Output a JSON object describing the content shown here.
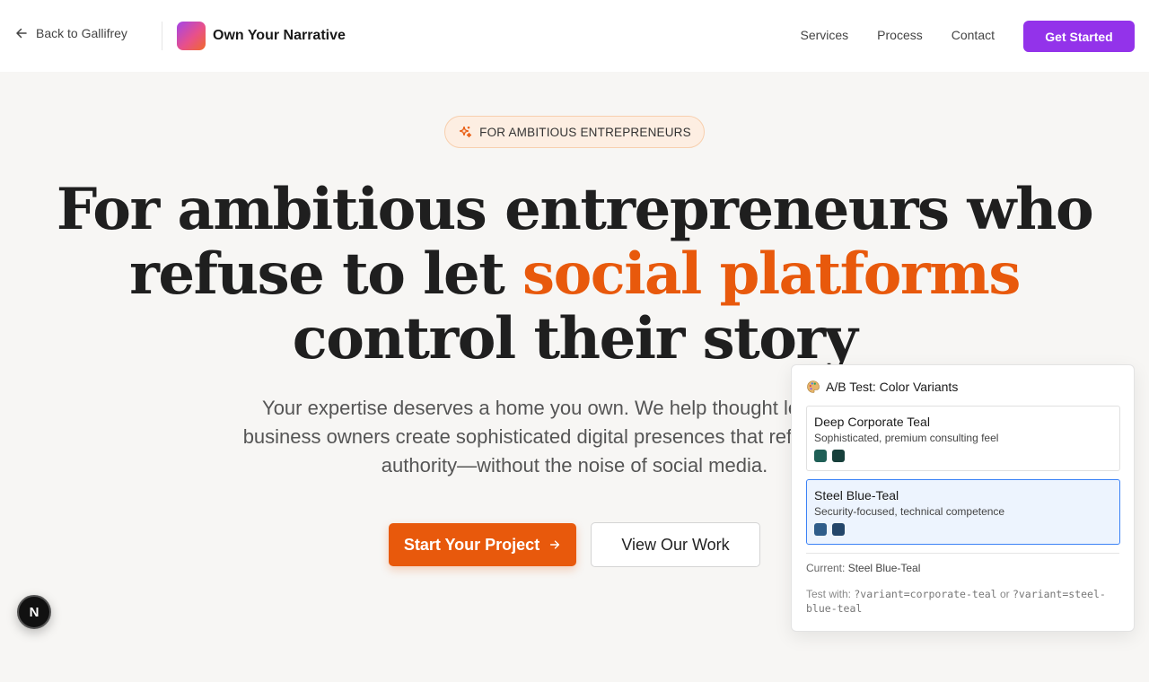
{
  "header": {
    "back_label": "Back to Gallifrey",
    "brand_name": "Own Your Narrative",
    "nav": [
      "Services",
      "Process",
      "Contact"
    ],
    "cta_label": "Get Started"
  },
  "hero": {
    "badge": "FOR AMBITIOUS ENTREPRENEURS",
    "headline_line1": "For ambitious entrepreneurs who",
    "headline_line2_pre": "refuse to let ",
    "headline_accent": "social platforms",
    "headline_line3": "control their story",
    "subtext": "Your expertise deserves a home you own. We help thought leaders and business owners create sophisticated digital presences that reflect your true authority—without the noise of social media.",
    "primary_button": "Start Your Project",
    "secondary_button": "View Our Work"
  },
  "floating_button": {
    "label": "N"
  },
  "ab_panel": {
    "title": "A/B Test: Color Variants",
    "variants": [
      {
        "name": "Deep Corporate Teal",
        "description": "Sophisticated, premium consulting feel",
        "colors": [
          "#1f5f56",
          "#17403b"
        ],
        "selected": false
      },
      {
        "name": "Steel Blue-Teal",
        "description": "Security-focused, technical competence",
        "colors": [
          "#2f5d8a",
          "#24466a"
        ],
        "selected": true
      }
    ],
    "current_label": "Current: ",
    "current_value": "Steel Blue-Teal",
    "test_with_label": "Test with: ",
    "test_param_1": "?variant=corporate-teal",
    "test_or": " or ",
    "test_param_2": "?variant=steel-blue-teal"
  },
  "colors": {
    "accent": "#e8590c",
    "cta": "#9333ea",
    "badge_bg": "#fdeee2"
  }
}
